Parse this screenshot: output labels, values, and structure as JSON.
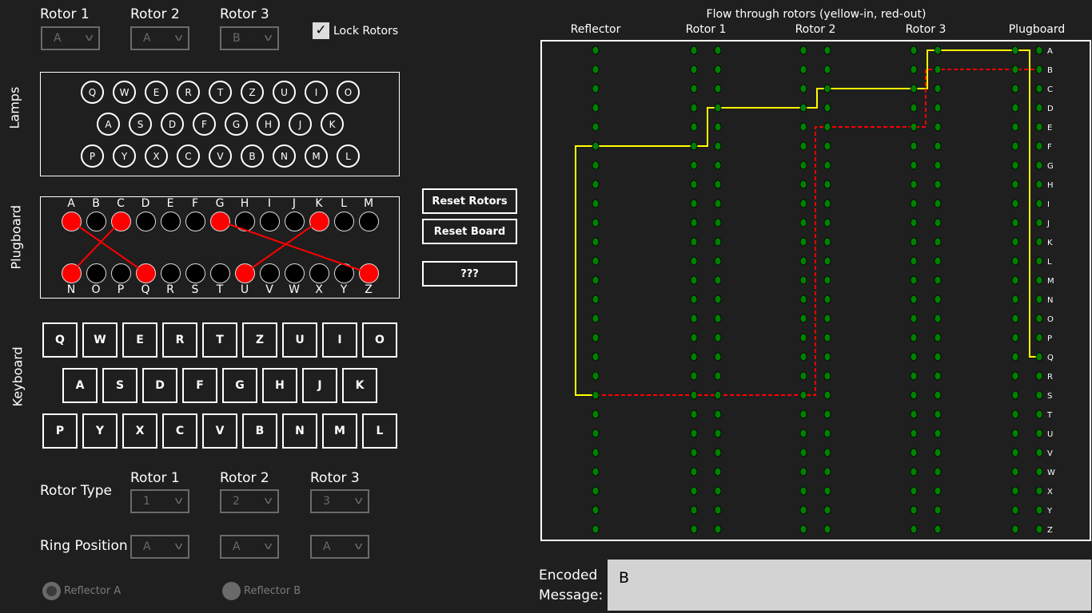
{
  "top_rotors": [
    {
      "label": "Rotor 1",
      "value": "A"
    },
    {
      "label": "Rotor 2",
      "value": "A"
    },
    {
      "label": "Rotor 3",
      "value": "B"
    }
  ],
  "lock_rotors": {
    "label": "Lock Rotors",
    "checked": true
  },
  "section_labels": {
    "lamps": "Lamps",
    "plugboard": "Plugboard",
    "keyboard": "Keyboard"
  },
  "lamps": [
    [
      "Q",
      "W",
      "E",
      "R",
      "T",
      "Z",
      "U",
      "I",
      "O"
    ],
    [
      "A",
      "S",
      "D",
      "F",
      "G",
      "H",
      "J",
      "K"
    ],
    [
      "P",
      "Y",
      "X",
      "C",
      "V",
      "B",
      "N",
      "M",
      "L"
    ]
  ],
  "plugboard": {
    "top": [
      "A",
      "B",
      "C",
      "D",
      "E",
      "F",
      "G",
      "H",
      "I",
      "J",
      "K",
      "L",
      "M"
    ],
    "bottom": [
      "N",
      "O",
      "P",
      "Q",
      "R",
      "S",
      "T",
      "U",
      "V",
      "W",
      "X",
      "Y",
      "Z"
    ],
    "pairs": [
      [
        "A",
        "Q"
      ],
      [
        "C",
        "N"
      ],
      [
        "G",
        "Z"
      ],
      [
        "K",
        "U"
      ]
    ],
    "active_color": "#ff0000"
  },
  "keyboard": [
    [
      "Q",
      "W",
      "E",
      "R",
      "T",
      "Z",
      "U",
      "I",
      "O"
    ],
    [
      "A",
      "S",
      "D",
      "F",
      "G",
      "H",
      "J",
      "K"
    ],
    [
      "P",
      "Y",
      "X",
      "C",
      "V",
      "B",
      "N",
      "M",
      "L"
    ]
  ],
  "buttons": {
    "reset_rotors": "Reset Rotors",
    "reset_board": "Reset Board",
    "mystery": "???"
  },
  "settings": {
    "rotor_type_label": "Rotor Type",
    "ring_position_label": "Ring Position",
    "rotors": [
      {
        "label": "Rotor 1",
        "type": "1",
        "ring": "A"
      },
      {
        "label": "Rotor 2",
        "type": "2",
        "ring": "A"
      },
      {
        "label": "Rotor 3",
        "type": "3",
        "ring": "A"
      }
    ]
  },
  "reflectors": [
    {
      "label": "Reflector A",
      "selected": true
    },
    {
      "label": "Reflector B",
      "selected": false
    }
  ],
  "flow": {
    "title": "Flow through rotors (yellow-in, red-out)",
    "columns": [
      "Reflector",
      "Rotor 1",
      "Rotor 2",
      "Rotor 3",
      "Plugboard"
    ],
    "letters": [
      "A",
      "B",
      "C",
      "D",
      "E",
      "F",
      "G",
      "H",
      "I",
      "J",
      "K",
      "L",
      "M",
      "N",
      "O",
      "P",
      "Q",
      "R",
      "S",
      "T",
      "U",
      "V",
      "W",
      "X",
      "Y",
      "Z"
    ],
    "in_color": "#ffff00",
    "out_color": "#ff0000",
    "dot_color": "#008000",
    "in_path": [
      "Q",
      "A",
      "A",
      "C",
      "C",
      "D",
      "D",
      "F",
      "F",
      "S"
    ],
    "out_path": [
      "S",
      "S",
      "S",
      "S",
      "E",
      "E",
      "B",
      "B",
      "B"
    ]
  },
  "encoded": {
    "label": "Encoded\nMessage:",
    "value": "B"
  }
}
